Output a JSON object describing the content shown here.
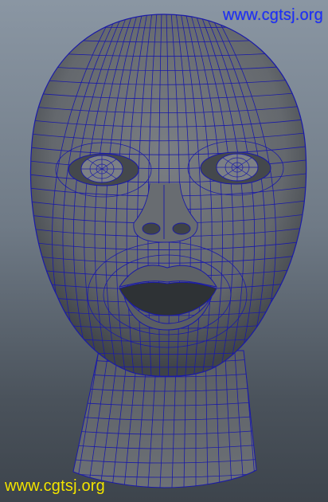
{
  "viewport": {
    "subject": "head-wireframe-model",
    "colors": {
      "background_top": "#8a96a3",
      "background_bottom": "#3d444c",
      "mesh_fill": "#6a6e72",
      "mesh_wire": "#1a1aa8"
    }
  },
  "watermarks": {
    "top": {
      "text": "www.cgtsj.org",
      "color": "#1a2cff"
    },
    "bottom": {
      "text": "www.cgtsj.org",
      "color": "#f4e600"
    }
  }
}
